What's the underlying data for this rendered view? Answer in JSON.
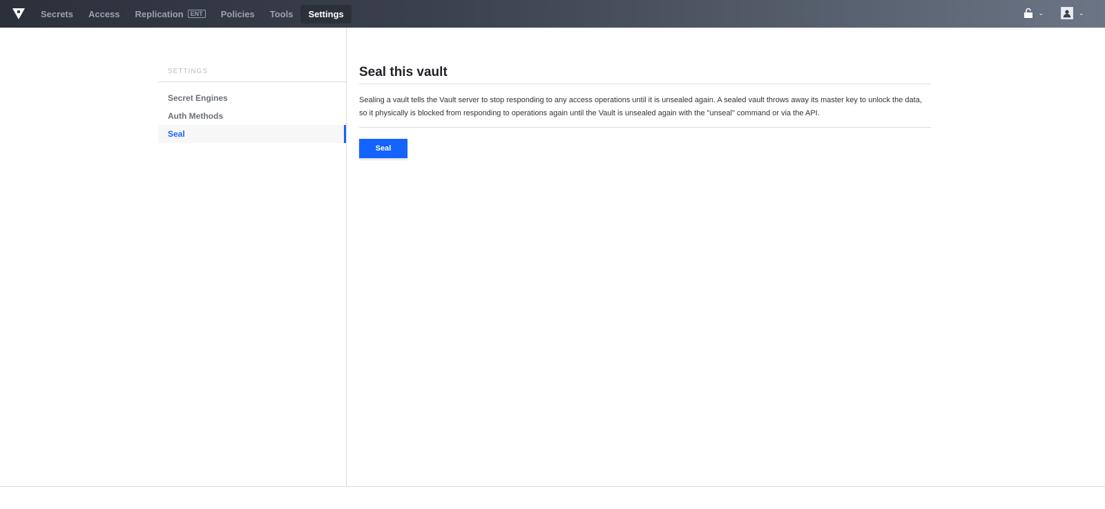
{
  "nav": {
    "items": [
      {
        "label": "Secrets"
      },
      {
        "label": "Access"
      },
      {
        "label": "Replication",
        "badge": "ENT"
      },
      {
        "label": "Policies"
      },
      {
        "label": "Tools"
      },
      {
        "label": "Settings",
        "active": true
      }
    ]
  },
  "sidebar": {
    "heading": "SETTINGS",
    "items": [
      {
        "label": "Secret Engines"
      },
      {
        "label": "Auth Methods"
      },
      {
        "label": "Seal",
        "active": true
      }
    ]
  },
  "main": {
    "title": "Seal this vault",
    "description": "Sealing a vault tells the Vault server to stop responding to any access operations until it is unsealed again. A sealed vault throws away its master key to unlock the data, so it physically is blocked from responding to operations again until the Vault is unsealed again with the \"unseal\" command or via the API.",
    "seal_button": "Seal"
  },
  "colors": {
    "accent": "#1563ff",
    "nav_bg": "#2b303a"
  }
}
